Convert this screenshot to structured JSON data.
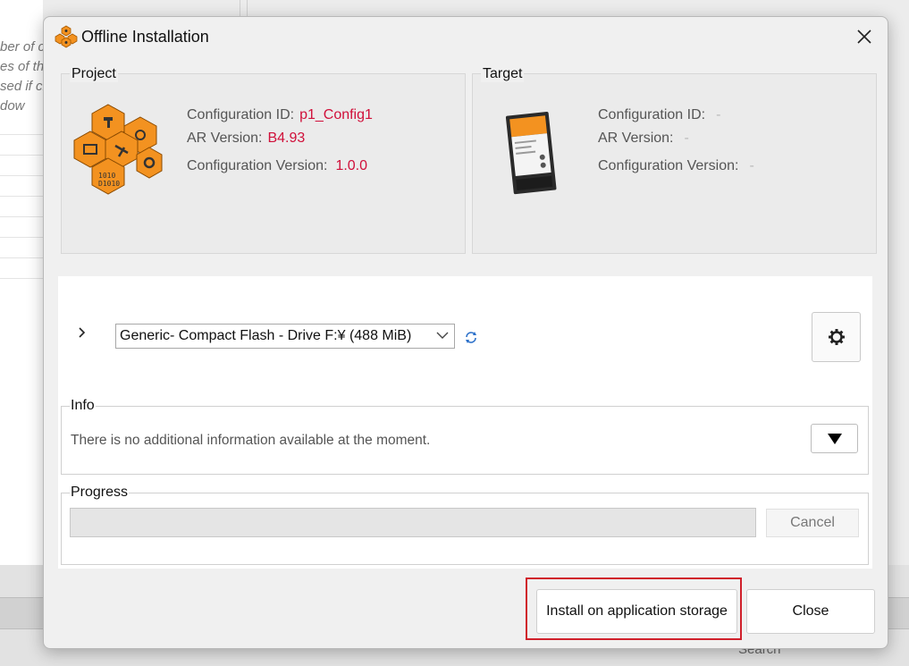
{
  "background": {
    "fragments": [
      "ber of c",
      "es of th",
      "sed if cl",
      "dow"
    ],
    "search_label": "Search"
  },
  "dialog": {
    "title": "Offline Installation",
    "project": {
      "label": "Project",
      "config_id_label": "Configuration ID:",
      "config_id_value": "p1_Config1",
      "ar_version_label": "AR Version:",
      "ar_version_value": "B4.93",
      "config_version_label": "Configuration Version:",
      "config_version_value": "1.0.0"
    },
    "target": {
      "label": "Target",
      "config_id_label": "Configuration ID:",
      "config_id_value": "-",
      "ar_version_label": "AR Version:",
      "ar_version_value": "-",
      "config_version_label": "Configuration Version:",
      "config_version_value": "-"
    },
    "drive": {
      "selected": "Generic- Compact Flash - Drive F:¥ (488 MiB)"
    },
    "info": {
      "label": "Info",
      "text": "There is no additional information available at the moment."
    },
    "progress": {
      "label": "Progress",
      "value": 0,
      "cancel_label": "Cancel"
    },
    "buttons": {
      "install_label": "Install on application storage",
      "close_label": "Close"
    }
  },
  "colors": {
    "value_red": "#d0103a",
    "highlight": "#d0202b",
    "icon_orange": "#f39220"
  }
}
